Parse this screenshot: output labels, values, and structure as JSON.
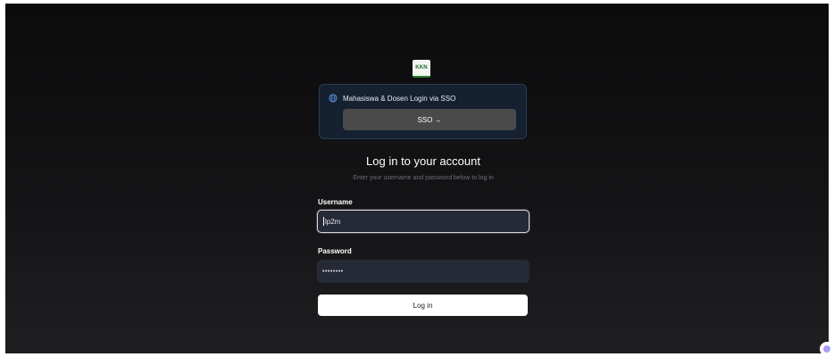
{
  "logo": {
    "text": "KKN"
  },
  "sso": {
    "label": "Mahasiswa & Dosen Login via SSO",
    "button_label": "SSO →"
  },
  "login": {
    "title": "Log in to your account",
    "subtitle": "Enter your username and password below to log in",
    "username_label": "Username",
    "username_value": "lp2m",
    "password_label": "Password",
    "password_value": "••••••••",
    "submit_label": "Log in"
  },
  "colors": {
    "sso_card_bg": "#152030",
    "input_bg": "#262a36",
    "primary_button": "#ffffff"
  }
}
